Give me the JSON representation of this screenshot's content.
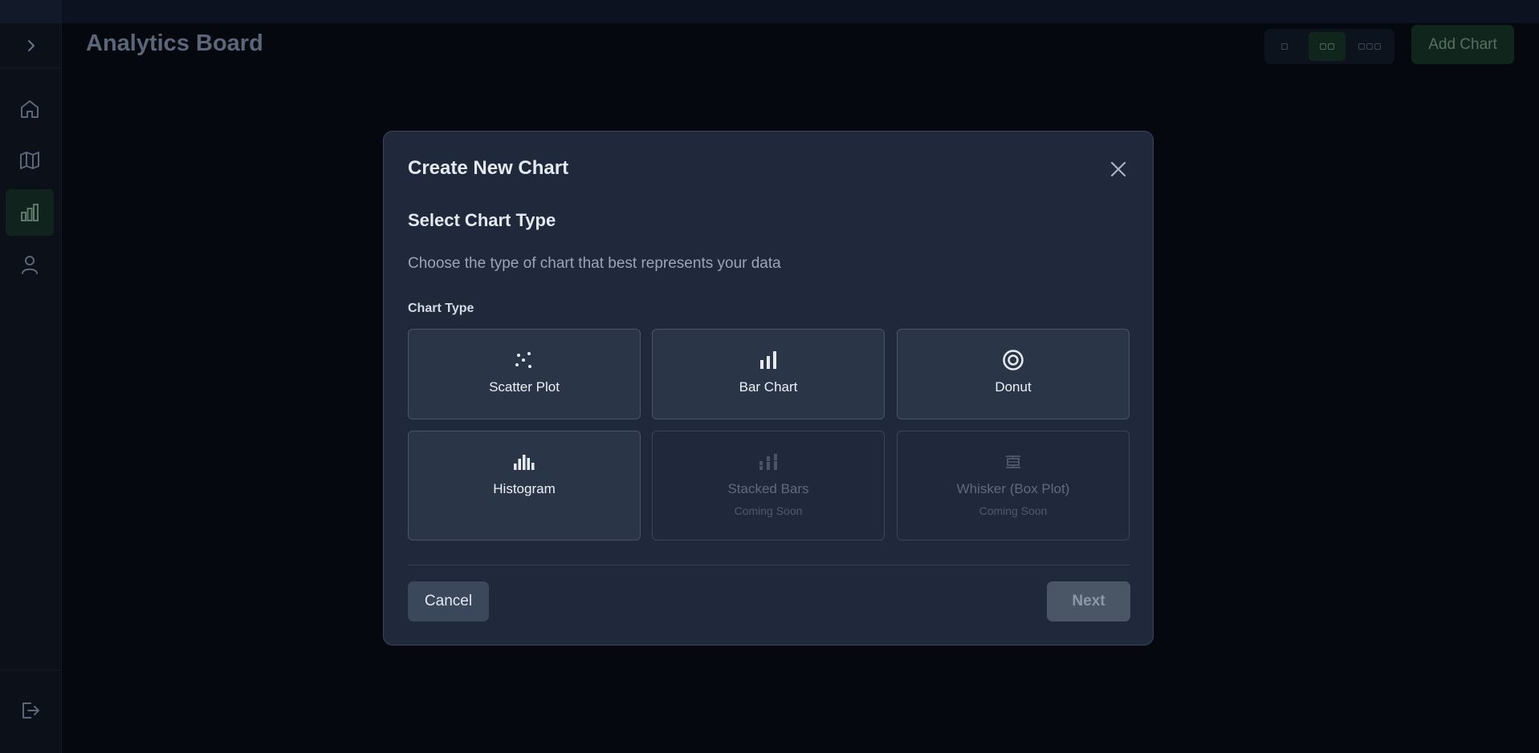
{
  "app": {
    "title": "Analytics Board",
    "add_chart_label": "Add Chart",
    "layout_options": [
      "single-column",
      "two-column",
      "three-column"
    ],
    "layout_selected": "two-column"
  },
  "sidebar": {
    "items": [
      {
        "icon": "home-icon",
        "active": false
      },
      {
        "icon": "map-icon",
        "active": false
      },
      {
        "icon": "bar-chart-icon",
        "active": true
      },
      {
        "icon": "user-icon",
        "active": false
      }
    ],
    "expand_icon": "chevron-right-icon",
    "logout_icon": "logout-icon"
  },
  "modal": {
    "title": "Create New Chart",
    "step_title": "Select Chart Type",
    "step_description": "Choose the type of chart that best represents your data",
    "field_label": "Chart Type",
    "chart_types": [
      {
        "label": "Scatter Plot",
        "icon": "scatter-plot-icon",
        "sub": ""
      },
      {
        "label": "Bar Chart",
        "icon": "bar-chart-icon",
        "sub": ""
      },
      {
        "label": "Donut",
        "icon": "donut-icon",
        "sub": ""
      },
      {
        "label": "Histogram",
        "icon": "histogram-icon",
        "sub": ""
      },
      {
        "label": "Stacked Bars",
        "icon": "stacked-bars-icon",
        "sub": "Coming Soon"
      },
      {
        "label": "Whisker (Box Plot)",
        "icon": "box-plot-icon",
        "sub": "Coming Soon"
      }
    ],
    "cancel_label": "Cancel",
    "next_label": "Next"
  },
  "colors": {
    "modal_bg": "#1f293b",
    "accent_green": "#10261c",
    "page_bg": "#05080f"
  }
}
